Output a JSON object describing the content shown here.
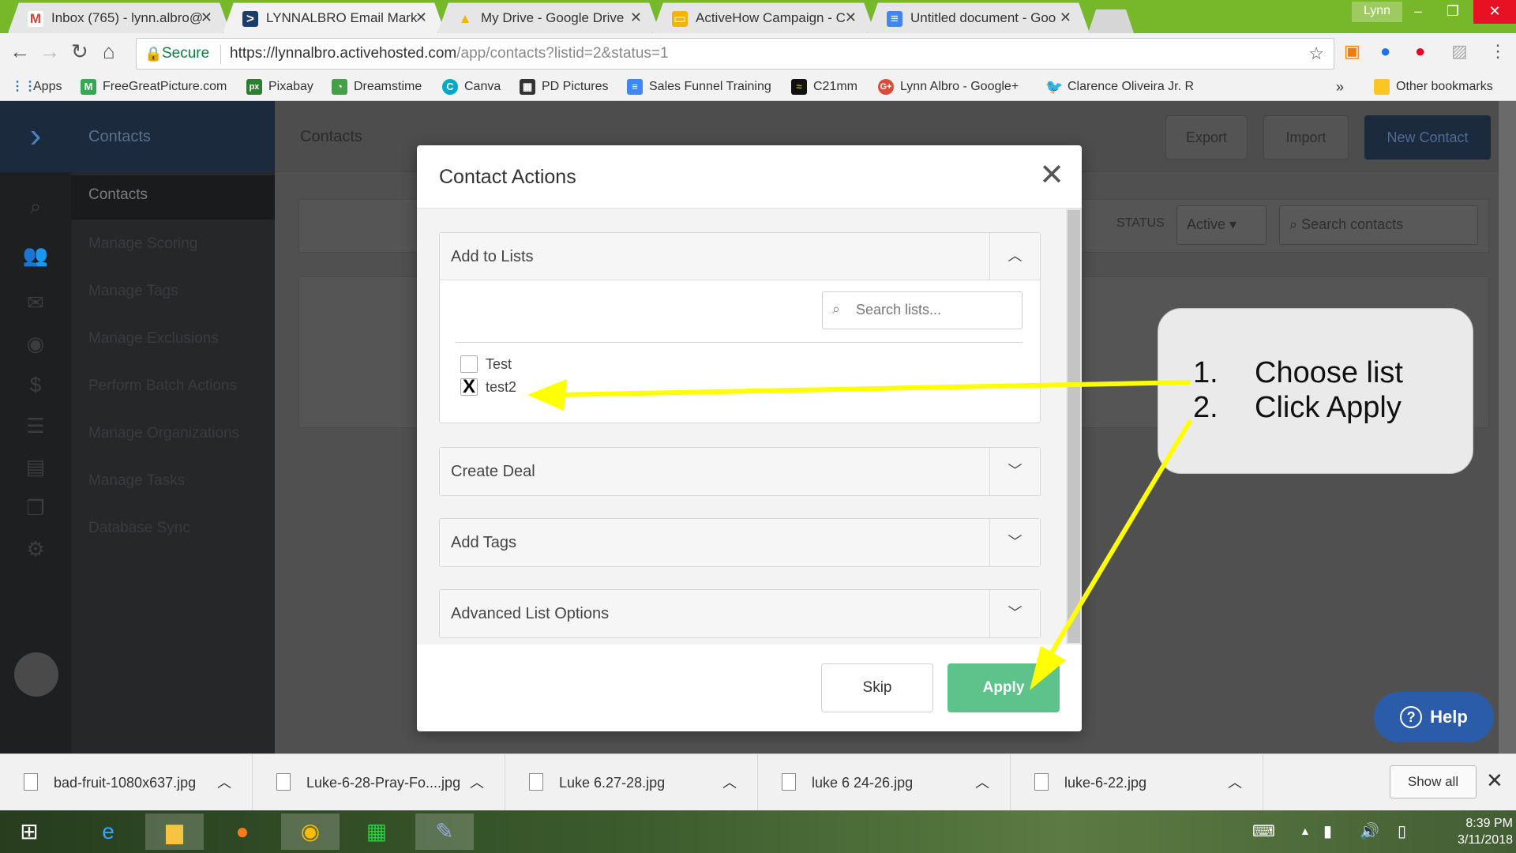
{
  "browser": {
    "tabs": [
      {
        "title": "Inbox (765) - lynn.albro@",
        "favicon_color": "#d44638",
        "favicon_glyph": "M"
      },
      {
        "title": "LYNNALBRO Email Mark",
        "favicon_color": "#1b3d6b",
        "favicon_glyph": ">"
      },
      {
        "title": "My Drive - Google Drive",
        "favicon_color": "#f4b400",
        "favicon_glyph": "▲"
      },
      {
        "title": "ActiveHow Campaign - C",
        "favicon_color": "#f4b400",
        "favicon_glyph": "▭"
      },
      {
        "title": "Untitled document - Goo",
        "favicon_color": "#4285f4",
        "favicon_glyph": "≡"
      }
    ],
    "profile_name": "Lynn",
    "secure_label": "Secure",
    "url_host": "https://lynnalbro.activehosted.com",
    "url_path": "/app/contacts?listid=2&status=1",
    "bookmarks": [
      {
        "label": "Apps",
        "icon": "apps-grid-icon",
        "color": "#1a73e8"
      },
      {
        "label": "FreeGreatPicture.com",
        "icon": "m-logo-icon",
        "color": "#34a853"
      },
      {
        "label": "Pixabay",
        "icon": "px-logo-icon",
        "color": "#2e7d32"
      },
      {
        "label": "Dreamstime",
        "icon": "dreamstime-logo-icon",
        "color": "#43a047"
      },
      {
        "label": "Canva",
        "icon": "canva-logo-icon",
        "color": "#00a8c6"
      },
      {
        "label": "PD Pictures",
        "icon": "pd-logo-icon",
        "color": "#333333"
      },
      {
        "label": "Sales Funnel Training",
        "icon": "doc-icon",
        "color": "#4285f4"
      },
      {
        "label": "C21mm",
        "icon": "c21-logo-icon",
        "color": "#111111"
      },
      {
        "label": "Lynn Albro - Google+",
        "icon": "google-plus-icon",
        "color": "#dd4b39"
      },
      {
        "label": "Clarence Oliveira Jr. R",
        "icon": "twitter-icon",
        "color": "#1da1f2"
      }
    ],
    "other_bookmarks": "Other bookmarks",
    "more_bookmarks": "»"
  },
  "app": {
    "sidebar_header": "Contacts",
    "subnav": [
      "Contacts",
      "Manage Scoring",
      "Manage Tags",
      "Manage Exclusions",
      "Perform Batch Actions",
      "Manage Organizations",
      "Manage Tasks",
      "Database Sync"
    ],
    "page_title": "Contacts",
    "export_label": "Export",
    "import_label": "Import",
    "new_contact_label": "New Contact",
    "status_label": "STATUS",
    "status_value": "Active",
    "search_placeholder": "Search contacts"
  },
  "modal": {
    "title": "Contact Actions",
    "sections": {
      "add_to_lists": "Add to Lists",
      "create_deal": "Create Deal",
      "add_tags": "Add Tags",
      "advanced": "Advanced List Options"
    },
    "search_lists_placeholder": "Search lists...",
    "lists": [
      {
        "label": "Test",
        "checked": false,
        "mark": ""
      },
      {
        "label": "test2",
        "checked": true,
        "mark": "X"
      }
    ],
    "skip_label": "Skip",
    "apply_label": "Apply"
  },
  "annotation": {
    "step1_num": "1.",
    "step1_text": "Choose list",
    "step2_num": "2.",
    "step2_text": "Click Apply",
    "arrow_color": "#ffff00"
  },
  "help_label": "Help",
  "downloads": [
    "bad-fruit-1080x637.jpg",
    "Luke-6-28-Pray-Fo....jpg",
    "Luke 6.27-28.jpg",
    "luke 6 24-26.jpg",
    "luke-6-22.jpg"
  ],
  "show_all_label": "Show all",
  "clock": {
    "time": "8:39 PM",
    "date": "3/11/2018"
  }
}
